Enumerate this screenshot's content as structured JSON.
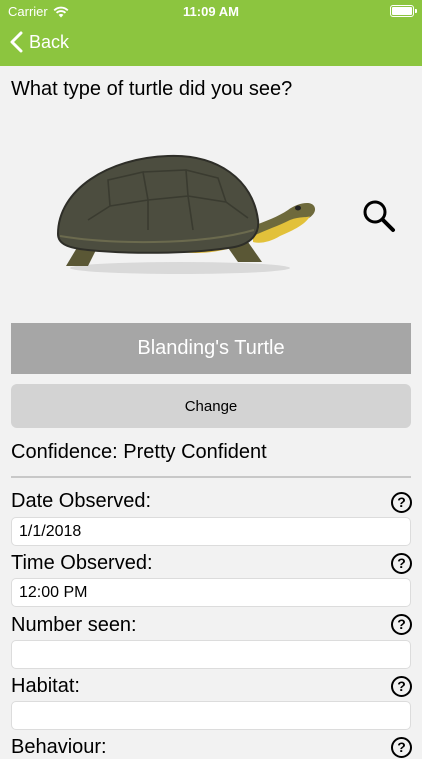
{
  "status_bar": {
    "carrier": "Carrier",
    "time": "11:09 AM"
  },
  "nav": {
    "back_label": "Back"
  },
  "question": "What type of turtle did you see?",
  "species": {
    "name": "Blanding's Turtle",
    "change_label": "Change"
  },
  "confidence": "Confidence: Pretty Confident",
  "fields": {
    "date": {
      "label": "Date Observed:",
      "value": "1/1/2018",
      "help": "?"
    },
    "time": {
      "label": "Time Observed:",
      "value": "12:00 PM",
      "help": "?"
    },
    "number": {
      "label": "Number seen:",
      "value": "",
      "help": "?"
    },
    "habitat": {
      "label": "Habitat:",
      "value": "",
      "help": "?"
    },
    "behaviour": {
      "label": "Behaviour:",
      "help": "?"
    }
  },
  "colors": {
    "accent": "#8cc53f",
    "banner": "#a6a6a6",
    "button": "#d3d3d3"
  }
}
